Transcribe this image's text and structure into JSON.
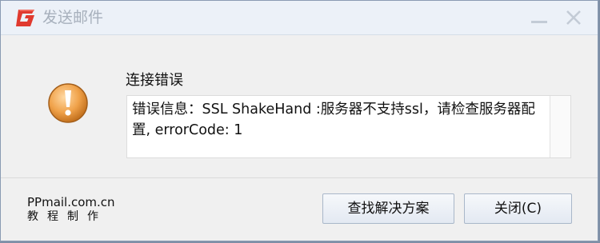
{
  "window": {
    "title": "发送邮件",
    "logo_icon": "ppmail-logo-icon",
    "minimize_icon": "minimize-icon",
    "close_icon": "close-icon"
  },
  "dialog": {
    "icon": "warning-exclamation-icon",
    "heading": "连接错误",
    "message": "错误信息：SSL ShakeHand :服务器不支持ssl，请检查服务器配置, errorCode: 1"
  },
  "footer": {
    "brand_line1": "PPmail.com.cn",
    "brand_line2": "教程制作",
    "solve_button": "查找解决方案",
    "close_button": "关闭(C)"
  },
  "colors": {
    "logo_red": "#e03a2f",
    "icon_orange": "#f0a24a",
    "title_text": "#a7b0bc"
  }
}
